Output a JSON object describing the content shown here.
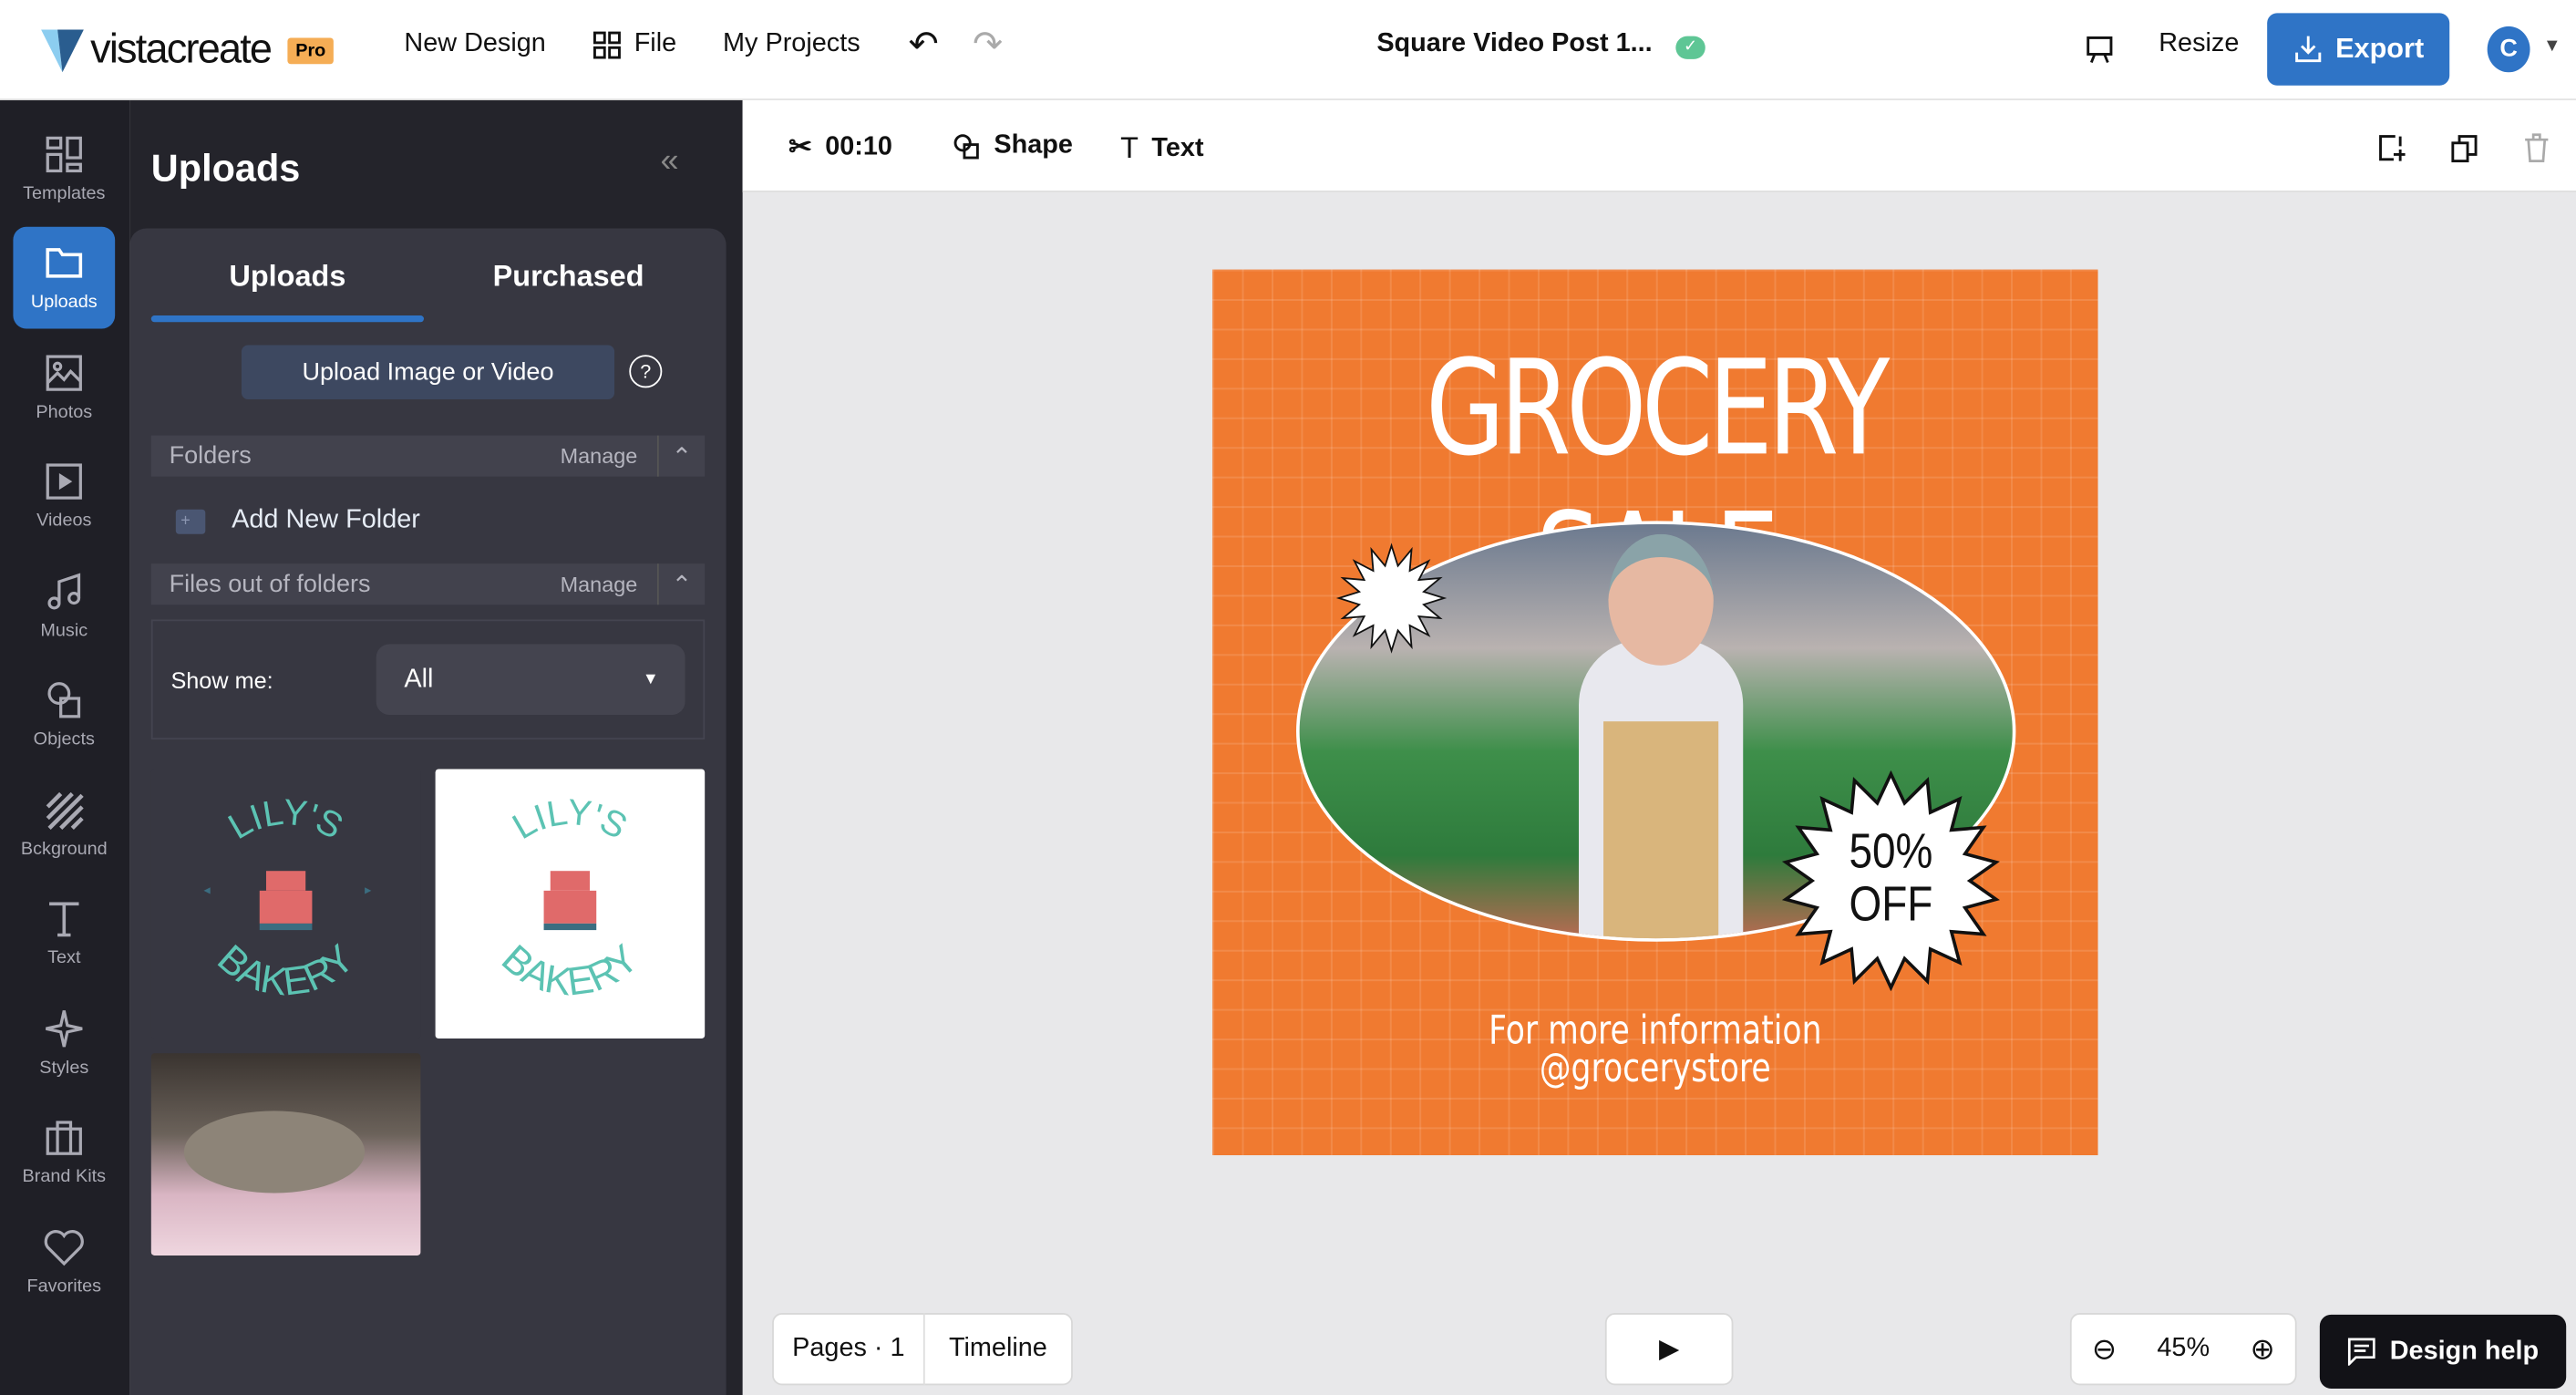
{
  "header": {
    "brand": "vistacreate",
    "badge": "Pro",
    "new_design": "New Design",
    "file": "File",
    "my_projects": "My Projects",
    "doc_title": "Square Video Post 1...",
    "resize": "Resize",
    "export": "Export",
    "avatar_initial": "C",
    "accent": "#2f74c6"
  },
  "rail": [
    {
      "label": "Templates",
      "icon": "templates-icon"
    },
    {
      "label": "Uploads",
      "icon": "folder-icon",
      "active": true
    },
    {
      "label": "Photos",
      "icon": "photo-icon"
    },
    {
      "label": "Videos",
      "icon": "video-icon"
    },
    {
      "label": "Music",
      "icon": "music-icon"
    },
    {
      "label": "Objects",
      "icon": "objects-icon"
    },
    {
      "label": "Bckground",
      "icon": "background-icon"
    },
    {
      "label": "Text",
      "icon": "text-icon"
    },
    {
      "label": "Styles",
      "icon": "styles-icon"
    },
    {
      "label": "Brand Kits",
      "icon": "brand-kit-icon"
    },
    {
      "label": "Favorites",
      "icon": "heart-icon"
    }
  ],
  "panel": {
    "title": "Uploads",
    "tabs": [
      "Uploads",
      "Purchased"
    ],
    "active_tab": "Uploads",
    "upload_button": "Upload Image or Video",
    "folders": "Folders",
    "manage": "Manage",
    "add_folder": "Add New Folder",
    "files_out": "Files out of folders",
    "show_me": "Show me:",
    "show_me_value": "All",
    "thumbs": [
      {
        "logo_top": "LILY'S",
        "logo_bottom": "BAKERY",
        "bg": "dark"
      },
      {
        "logo_top": "LILY'S",
        "logo_bottom": "BAKERY",
        "bg": "white"
      },
      {
        "kind": "cat photo"
      }
    ]
  },
  "toolbar": {
    "duration": "00:10",
    "shape": "Shape",
    "text": "Text"
  },
  "design": {
    "bg": "#f07a30",
    "headline": "GROCERY SALE",
    "badge_line1": "50%",
    "badge_line2": "OFF",
    "footer_line1": "For more information",
    "footer_line2": "@grocerystore"
  },
  "bottom": {
    "pages": "Pages · 1",
    "timeline": "Timeline",
    "zoom": "45%",
    "design_help": "Design help"
  }
}
